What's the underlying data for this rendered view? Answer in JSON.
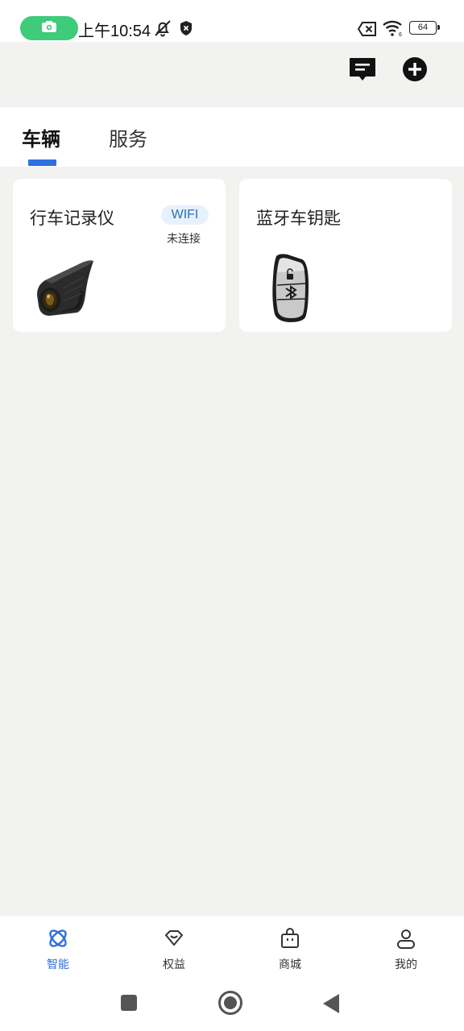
{
  "status_bar": {
    "time": "上午10:54",
    "battery_level": "64",
    "icons": [
      "camera-icon",
      "bell-off-icon",
      "shield-icon",
      "sim-off-icon",
      "wifi-icon",
      "battery-icon"
    ]
  },
  "top_actions": {
    "icons": [
      "message-icon",
      "add-circle-icon"
    ]
  },
  "tabs": [
    {
      "label": "车辆",
      "active": true
    },
    {
      "label": "服务",
      "active": false
    }
  ],
  "devices": [
    {
      "title": "行车记录仪",
      "badge": "WIFI",
      "status": "未连接",
      "image": "dashcam-image"
    },
    {
      "title": "蓝牙车钥匙",
      "image": "bluetooth-car-key-image"
    }
  ],
  "bottom_nav": [
    {
      "label": "智能",
      "icon": "smart-icon",
      "active": true
    },
    {
      "label": "权益",
      "icon": "benefits-icon",
      "active": false
    },
    {
      "label": "商城",
      "icon": "shop-bag-icon",
      "active": false
    },
    {
      "label": "我的",
      "icon": "profile-icon",
      "active": false
    }
  ],
  "colors": {
    "accent": "#2f6fe0",
    "background": "#f2f2f1",
    "card": "#ffffff",
    "camera_pill": "#3ecb7a",
    "badge_bg": "#e6f1fb"
  }
}
